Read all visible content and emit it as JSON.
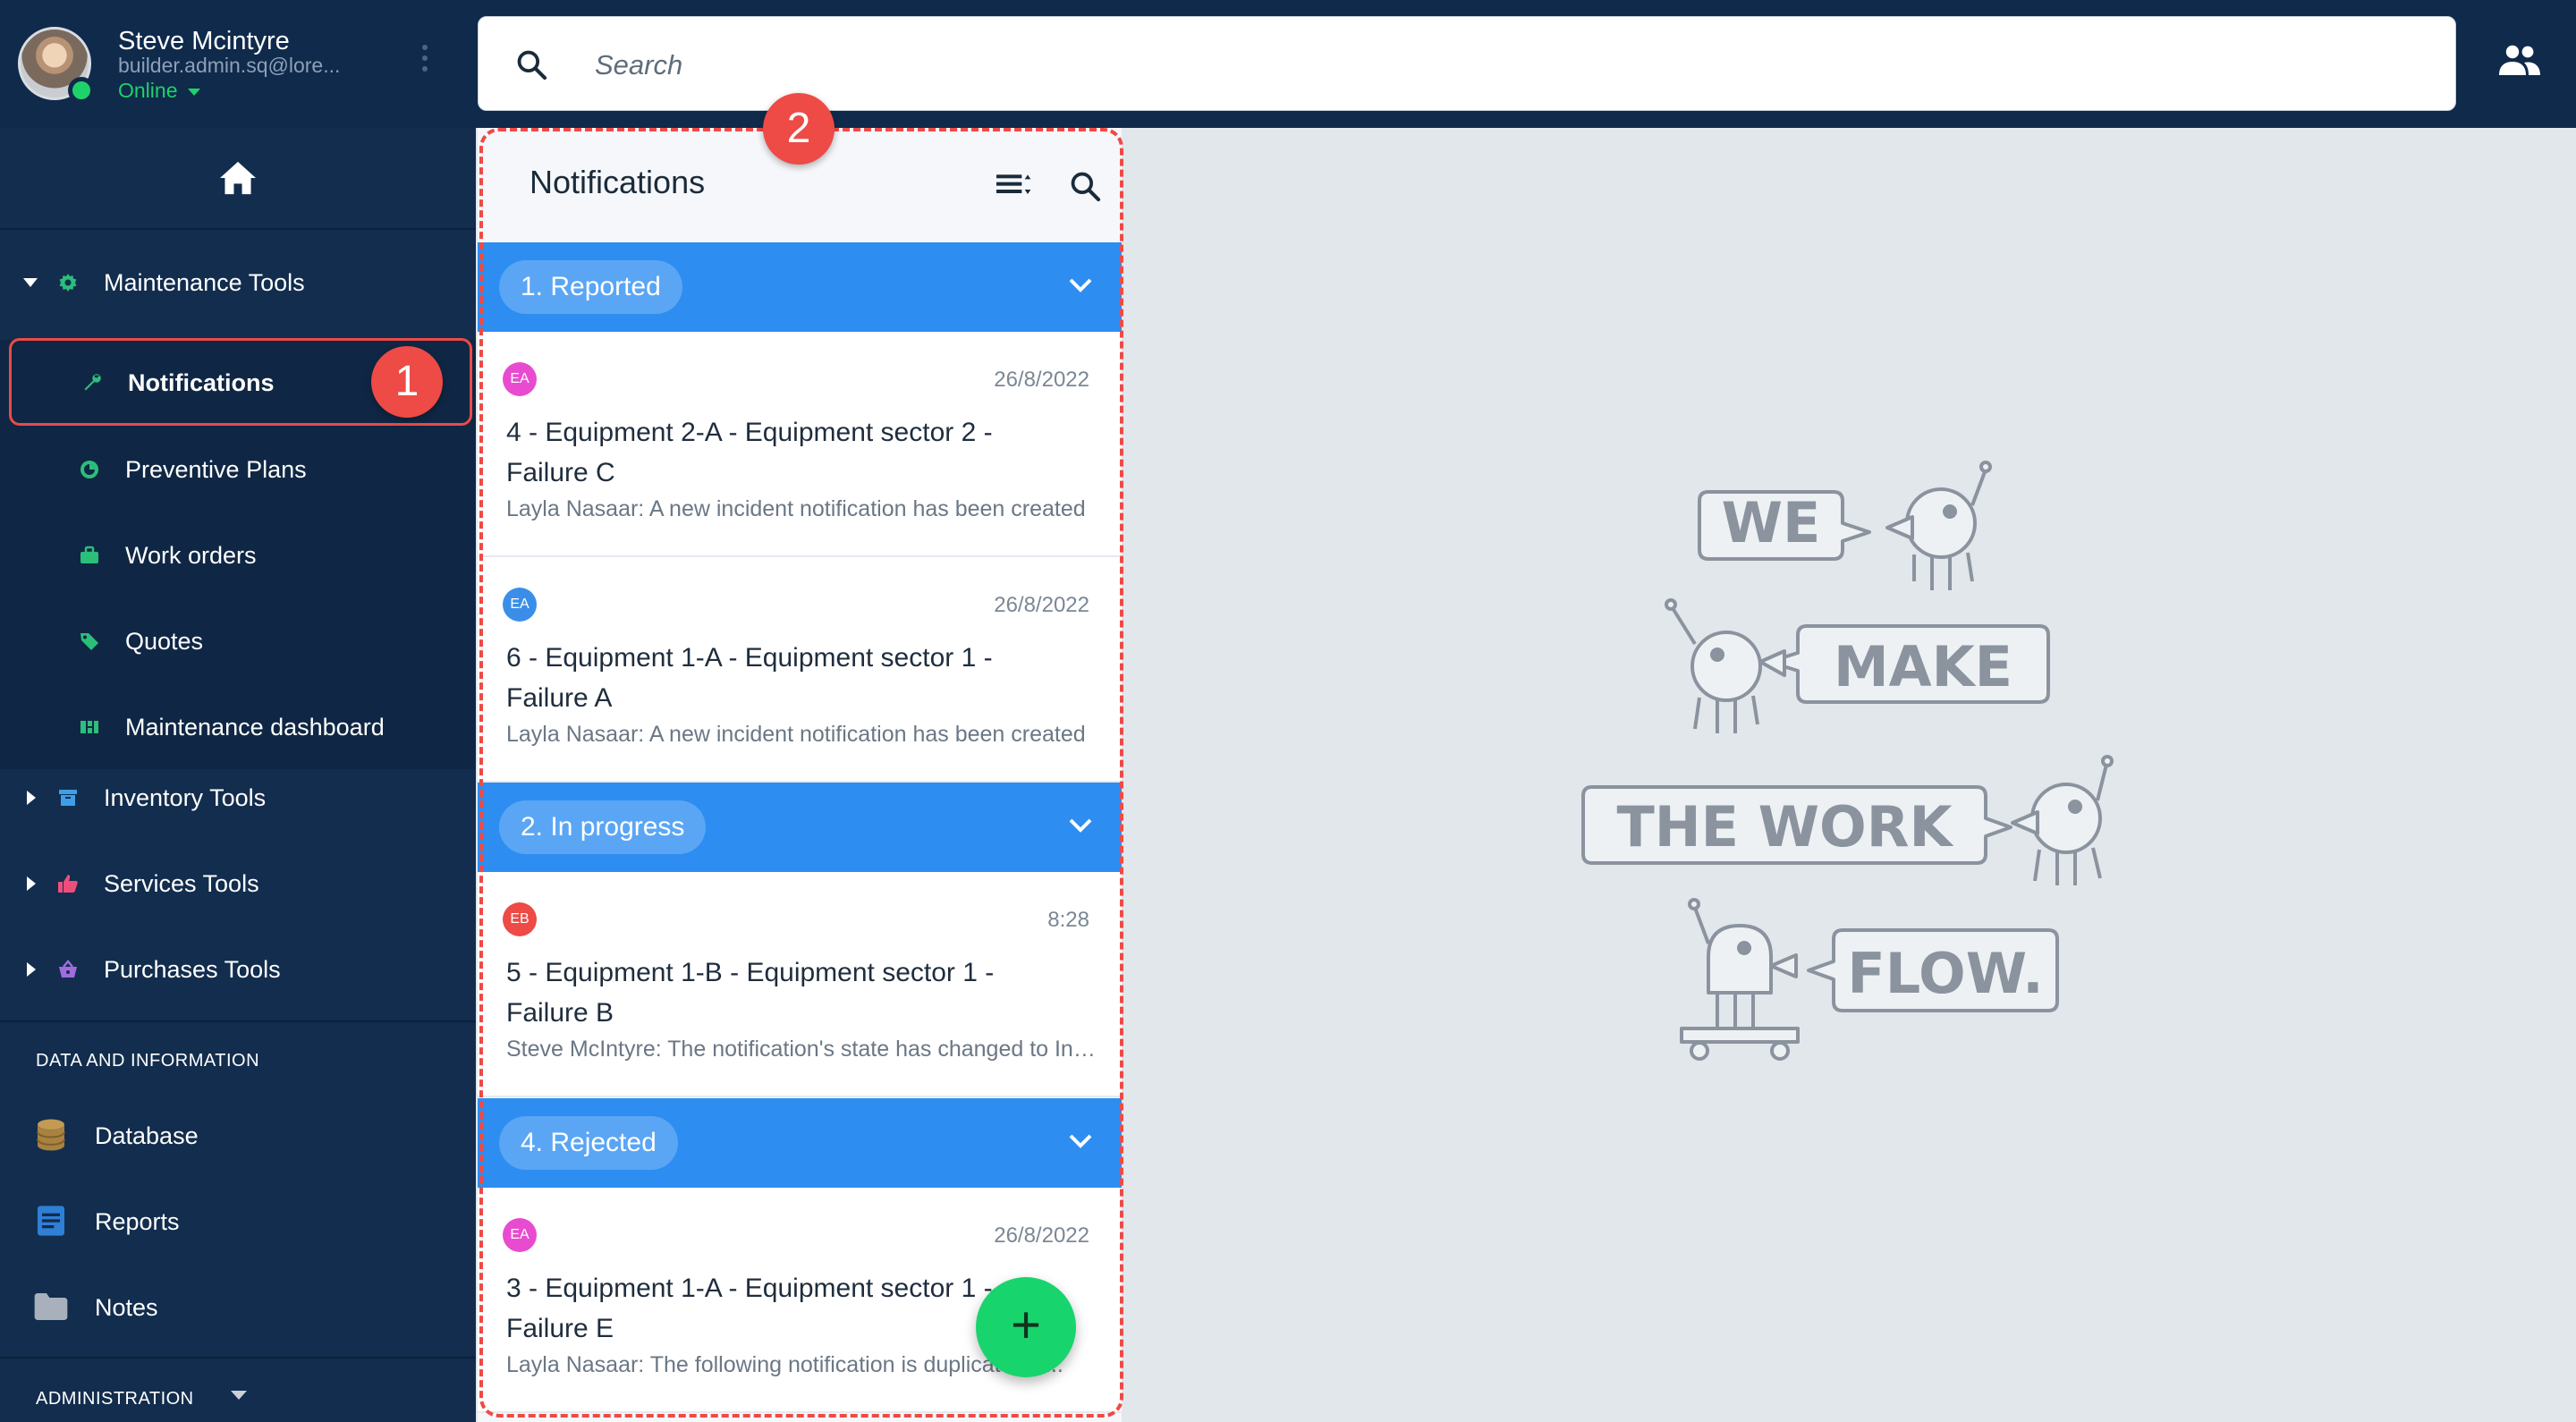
{
  "user": {
    "name": "Steve Mcintyre",
    "email": "builder.admin.sq@lore...",
    "status": "Online"
  },
  "search": {
    "placeholder": "Search"
  },
  "sidebar": {
    "groups": [
      {
        "label": "Maintenance Tools",
        "expanded": true
      },
      {
        "label": "Inventory Tools",
        "expanded": false
      },
      {
        "label": "Services Tools",
        "expanded": false
      },
      {
        "label": "Purchases Tools",
        "expanded": false
      }
    ],
    "maintenance_items": [
      {
        "label": "Notifications",
        "active": true
      },
      {
        "label": "Preventive Plans"
      },
      {
        "label": "Work orders"
      },
      {
        "label": "Quotes"
      },
      {
        "label": "Maintenance dashboard"
      }
    ],
    "data_section_title": "DATA AND INFORMATION",
    "data_items": [
      {
        "label": "Database"
      },
      {
        "label": "Reports"
      },
      {
        "label": "Notes"
      }
    ],
    "admin_section_title": "ADMINISTRATION"
  },
  "callouts": {
    "one": "1",
    "two": "2"
  },
  "panel": {
    "title": "Notifications",
    "groups": [
      {
        "label": "1. Reported",
        "items": [
          {
            "initials": "EA",
            "color": "#e84bd0",
            "date": "26/8/2022",
            "title": "4 - Equipment 2-A - Equipment sector 2 - Failure C",
            "body": "Layla Nasaar: A new incident notification has been created"
          },
          {
            "initials": "EA",
            "color": "#3b8ee8",
            "date": "26/8/2022",
            "title": "6 - Equipment 1-A - Equipment sector 1 - Failure A",
            "body": "Layla Nasaar: A new incident notification has been created"
          }
        ]
      },
      {
        "label": "2. In progress",
        "items": [
          {
            "initials": "EB",
            "color": "#ee4a46",
            "date": "8:28",
            "title": "5 - Equipment 1-B - Equipment sector 1 - Failure B",
            "body": "Steve McIntyre: The notification's state has changed to In progress"
          }
        ]
      },
      {
        "label": "4. Rejected",
        "items": [
          {
            "initials": "EA",
            "color": "#e84bd0",
            "date": "26/8/2022",
            "title": "3 - Equipment 1-A - Equipment sector 1 - Failure E",
            "body": "Layla Nasaar: The following notification is duplicated <..."
          }
        ]
      }
    ],
    "fab_label": "+"
  },
  "illustration": {
    "words": [
      "WE",
      "MAKE",
      "THE WORK",
      "FLOW."
    ]
  },
  "colors": {
    "topbar": "#0f2a4b",
    "sidebar": "#122d4d",
    "group_bar": "#2e8df0",
    "accent_red": "#ee4a46",
    "online_green": "#1fd16a",
    "fab_green": "#18d46d"
  }
}
